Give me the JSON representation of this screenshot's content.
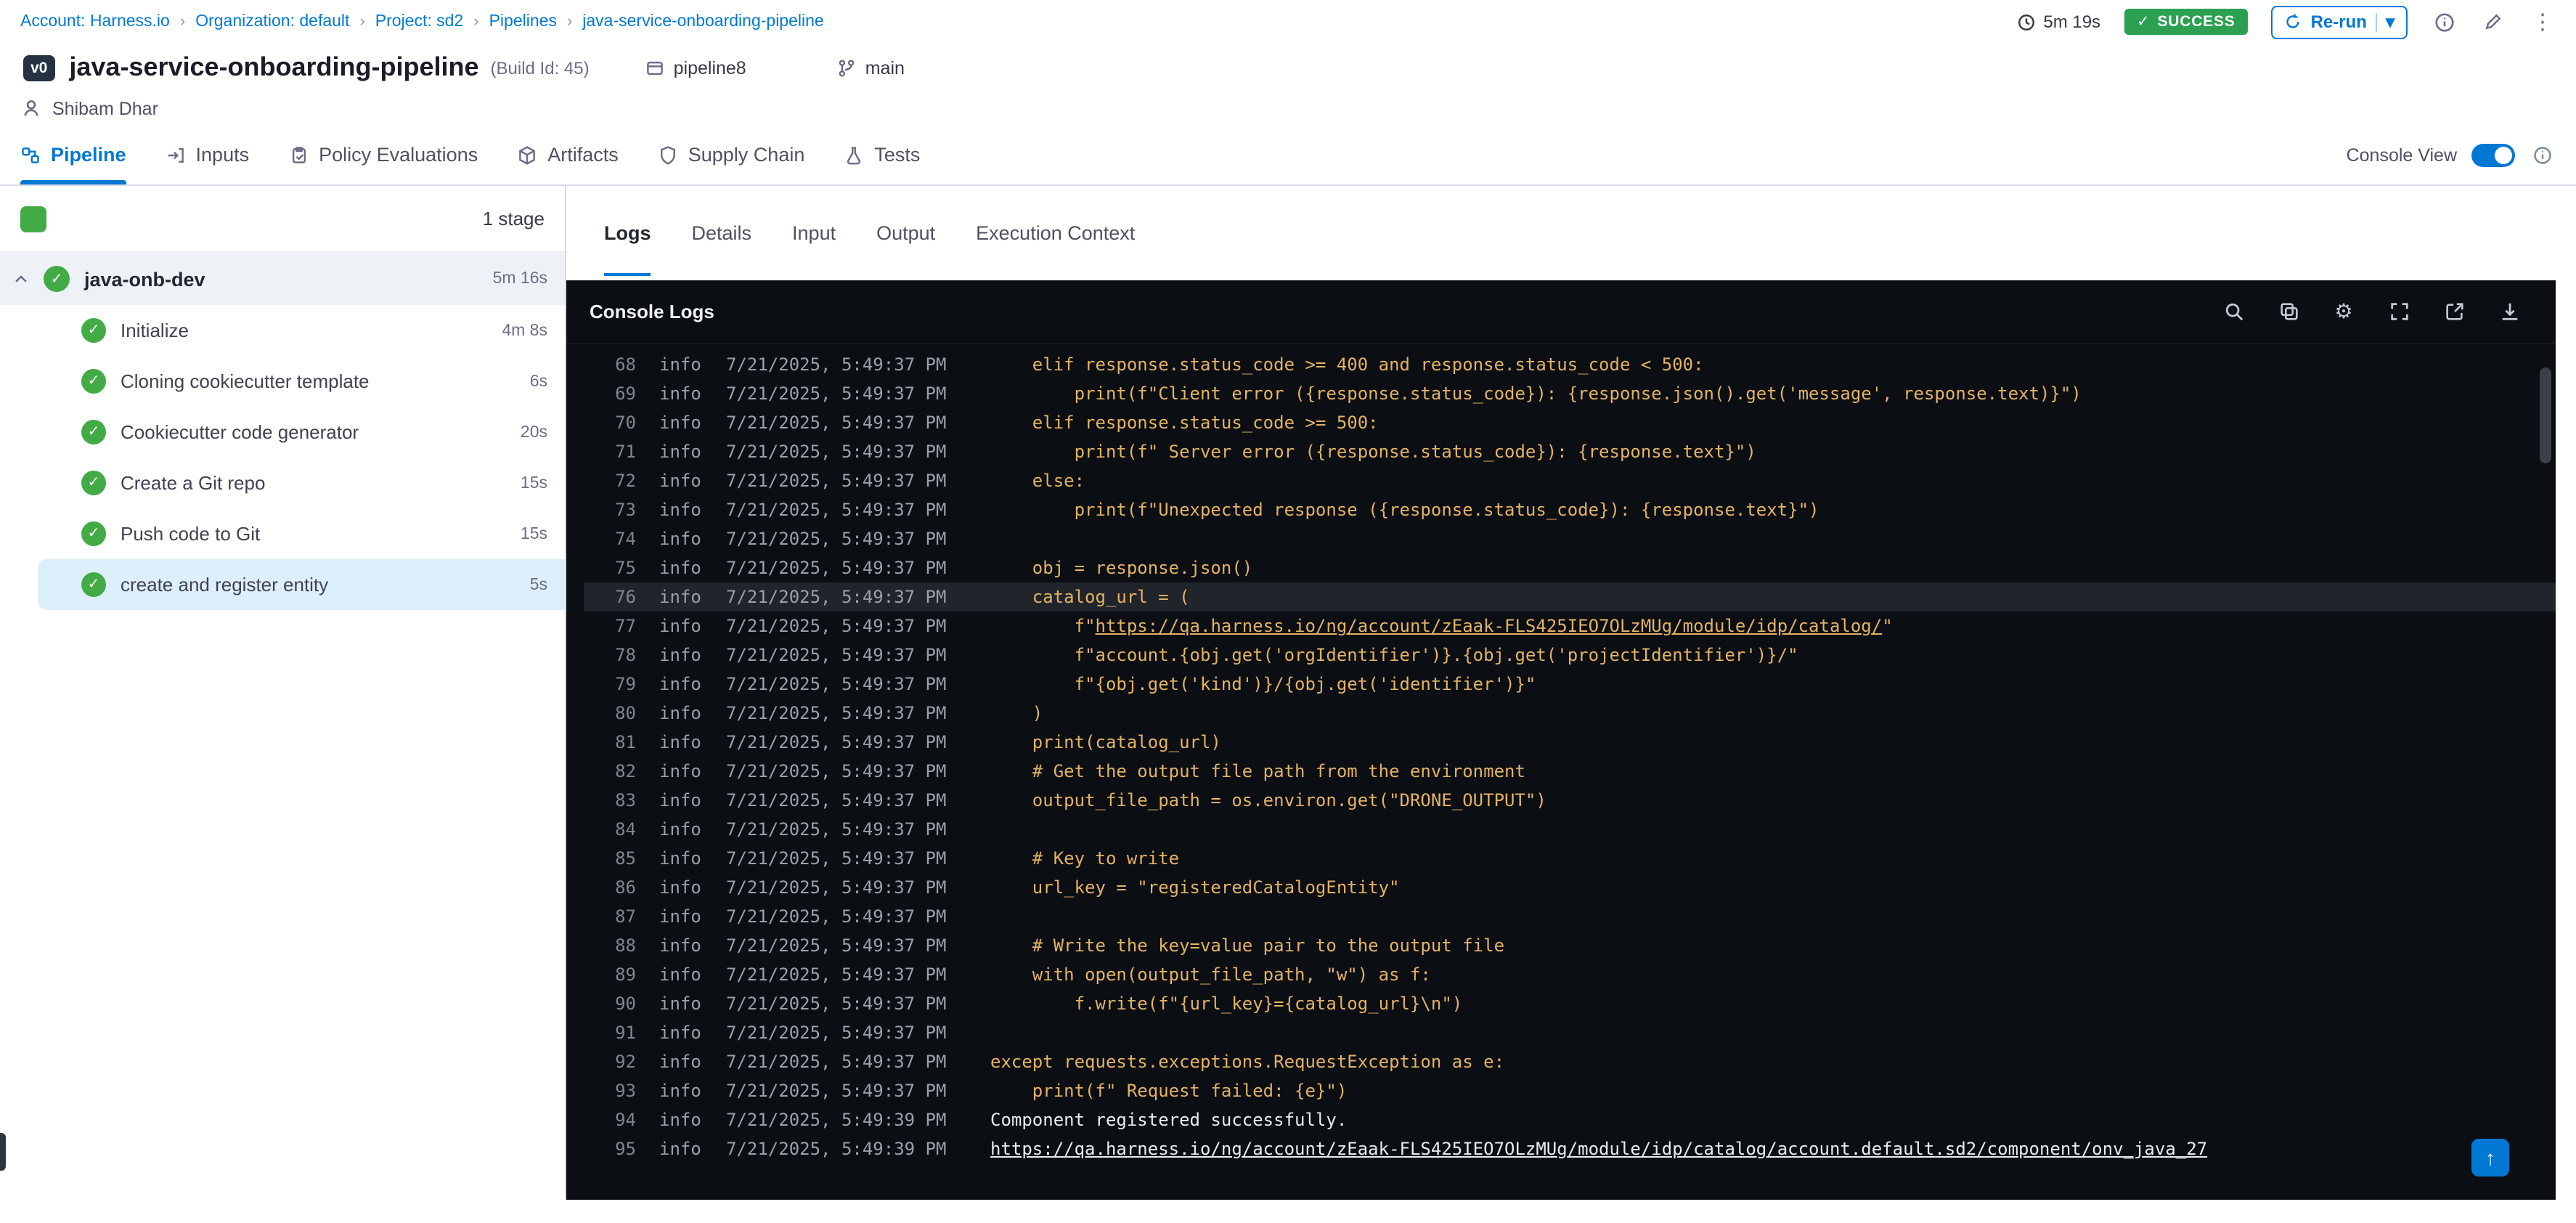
{
  "icons": {
    "check": "✓",
    "gear": "⚙",
    "kebab": "⋮",
    "caret": "▾",
    "up_arrow": "↑",
    "separator": "›"
  },
  "colors": {
    "accent": "#0278d5",
    "success_green": "#2ba050",
    "step_green": "#42ab45",
    "console_bg": "#0b0e13",
    "log_code": "#e3b263"
  },
  "breadcrumb": {
    "items": [
      "Account: Harness.io",
      "Organization: default",
      "Project: sd2",
      "Pipelines",
      "java-service-onboarding-pipeline"
    ]
  },
  "topbar": {
    "duration": "5m 19s",
    "status": "SUCCESS",
    "rerun": "Re-run"
  },
  "header": {
    "version": "v0",
    "title": "java-service-onboarding-pipeline",
    "build": "(Build Id: 45)",
    "pipeline_tag": "pipeline8",
    "branch": "main",
    "user": "Shibam Dhar"
  },
  "tabs": {
    "items": [
      {
        "label": "Pipeline"
      },
      {
        "label": "Inputs"
      },
      {
        "label": "Policy Evaluations"
      },
      {
        "label": "Artifacts"
      },
      {
        "label": "Supply Chain"
      },
      {
        "label": "Tests"
      }
    ],
    "console_view": "Console View"
  },
  "sidebar": {
    "stage_count": "1 stage",
    "stage": {
      "name": "java-onb-dev",
      "duration": "5m 16s"
    },
    "steps": [
      {
        "name": "Initialize",
        "duration": "4m 8s"
      },
      {
        "name": "Cloning cookiecutter template",
        "duration": "6s"
      },
      {
        "name": "Cookiecutter code generator",
        "duration": "20s"
      },
      {
        "name": "Create a Git repo",
        "duration": "15s"
      },
      {
        "name": "Push code to Git",
        "duration": "15s"
      },
      {
        "name": "create and register entity",
        "duration": "5s",
        "selected": true
      }
    ]
  },
  "logtabs": {
    "items": [
      "Logs",
      "Details",
      "Input",
      "Output",
      "Execution Context"
    ]
  },
  "console": {
    "title": "Console Logs",
    "lines": [
      {
        "n": 68,
        "lvl": "info",
        "ts": "7/21/2025, 5:49:37 PM",
        "text": "    elif response.status_code >= 400 and response.status_code < 500:"
      },
      {
        "n": 69,
        "lvl": "info",
        "ts": "7/21/2025, 5:49:37 PM",
        "text": "        print(f\"Client error ({response.status_code}): {response.json().get('message', response.text)}\")"
      },
      {
        "n": 70,
        "lvl": "info",
        "ts": "7/21/2025, 5:49:37 PM",
        "text": "    elif response.status_code >= 500:"
      },
      {
        "n": 71,
        "lvl": "info",
        "ts": "7/21/2025, 5:49:37 PM",
        "text": "        print(f\" Server error ({response.status_code}): {response.text}\")"
      },
      {
        "n": 72,
        "lvl": "info",
        "ts": "7/21/2025, 5:49:37 PM",
        "text": "    else:"
      },
      {
        "n": 73,
        "lvl": "info",
        "ts": "7/21/2025, 5:49:37 PM",
        "text": "        print(f\"Unexpected response ({response.status_code}): {response.text}\")"
      },
      {
        "n": 74,
        "lvl": "info",
        "ts": "7/21/2025, 5:49:37 PM",
        "text": ""
      },
      {
        "n": 75,
        "lvl": "info",
        "ts": "7/21/2025, 5:49:37 PM",
        "text": "    obj = response.json()"
      },
      {
        "n": 76,
        "lvl": "info",
        "ts": "7/21/2025, 5:49:37 PM",
        "text": "    catalog_url = (",
        "cls": "hl"
      },
      {
        "n": 77,
        "lvl": "info",
        "ts": "7/21/2025, 5:49:37 PM",
        "seg": [
          [
            "t",
            "        f\""
          ],
          [
            "u",
            "https://qa.harness.io/ng/account/zEaak-FLS425IEO7OLzMUg/module/idp/catalog/"
          ],
          [
            "t",
            "\""
          ]
        ]
      },
      {
        "n": 78,
        "lvl": "info",
        "ts": "7/21/2025, 5:49:37 PM",
        "text": "        f\"account.{obj.get('orgIdentifier')}.{obj.get('projectIdentifier')}/\""
      },
      {
        "n": 79,
        "lvl": "info",
        "ts": "7/21/2025, 5:49:37 PM",
        "text": "        f\"{obj.get('kind')}/{obj.get('identifier')}\""
      },
      {
        "n": 80,
        "lvl": "info",
        "ts": "7/21/2025, 5:49:37 PM",
        "text": "    )"
      },
      {
        "n": 81,
        "lvl": "info",
        "ts": "7/21/2025, 5:49:37 PM",
        "text": "    print(catalog_url)"
      },
      {
        "n": 82,
        "lvl": "info",
        "ts": "7/21/2025, 5:49:37 PM",
        "text": "    # Get the output file path from the environment"
      },
      {
        "n": 83,
        "lvl": "info",
        "ts": "7/21/2025, 5:49:37 PM",
        "text": "    output_file_path = os.environ.get(\"DRONE_OUTPUT\")"
      },
      {
        "n": 84,
        "lvl": "info",
        "ts": "7/21/2025, 5:49:37 PM",
        "text": ""
      },
      {
        "n": 85,
        "lvl": "info",
        "ts": "7/21/2025, 5:49:37 PM",
        "text": "    # Key to write"
      },
      {
        "n": 86,
        "lvl": "info",
        "ts": "7/21/2025, 5:49:37 PM",
        "text": "    url_key = \"registeredCatalogEntity\""
      },
      {
        "n": 87,
        "lvl": "info",
        "ts": "7/21/2025, 5:49:37 PM",
        "text": ""
      },
      {
        "n": 88,
        "lvl": "info",
        "ts": "7/21/2025, 5:49:37 PM",
        "text": "    # Write the key=value pair to the output file"
      },
      {
        "n": 89,
        "lvl": "info",
        "ts": "7/21/2025, 5:49:37 PM",
        "text": "    with open(output_file_path, \"w\") as f:"
      },
      {
        "n": 90,
        "lvl": "info",
        "ts": "7/21/2025, 5:49:37 PM",
        "text": "        f.write(f\"{url_key}={catalog_url}\\n\")"
      },
      {
        "n": 91,
        "lvl": "info",
        "ts": "7/21/2025, 5:49:37 PM",
        "text": ""
      },
      {
        "n": 92,
        "lvl": "info",
        "ts": "7/21/2025, 5:49:37 PM",
        "text": "except requests.exceptions.RequestException as e:"
      },
      {
        "n": 93,
        "lvl": "info",
        "ts": "7/21/2025, 5:49:37 PM",
        "text": "    print(f\" Request failed: {e}\")"
      },
      {
        "n": 94,
        "lvl": "info",
        "ts": "7/21/2025, 5:49:39 PM",
        "text": "Component registered successfully.",
        "cls": "plain"
      },
      {
        "n": 95,
        "lvl": "info",
        "ts": "7/21/2025, 5:49:39 PM",
        "seg": [
          [
            "u",
            "https://qa.harness.io/ng/account/zEaak-FLS425IEO7OLzMUg/module/idp/catalog/account.default.sd2/component/onv_java_27"
          ]
        ],
        "cls": "plain"
      }
    ]
  }
}
